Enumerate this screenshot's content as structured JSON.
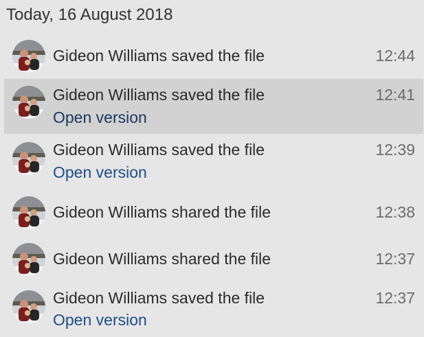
{
  "date_header": "Today, 16 August 2018",
  "activities": [
    {
      "message": "Gideon Williams saved the file",
      "time": "12:44",
      "link": ""
    },
    {
      "message": "Gideon Williams saved the file",
      "time": "12:41",
      "link": "Open version"
    },
    {
      "message": "Gideon Williams saved the file",
      "time": "12:39",
      "link": "Open version"
    },
    {
      "message": "Gideon Williams shared the file",
      "time": "12:38",
      "link": ""
    },
    {
      "message": "Gideon Williams shared the file",
      "time": "12:37",
      "link": ""
    },
    {
      "message": "Gideon Williams saved the file",
      "time": "12:37",
      "link": "Open version"
    }
  ],
  "colors": {
    "background": "#e6e6e6",
    "selected_row": "#d2d2d2",
    "link": "#1f4e87",
    "time": "#6b6b6b"
  }
}
